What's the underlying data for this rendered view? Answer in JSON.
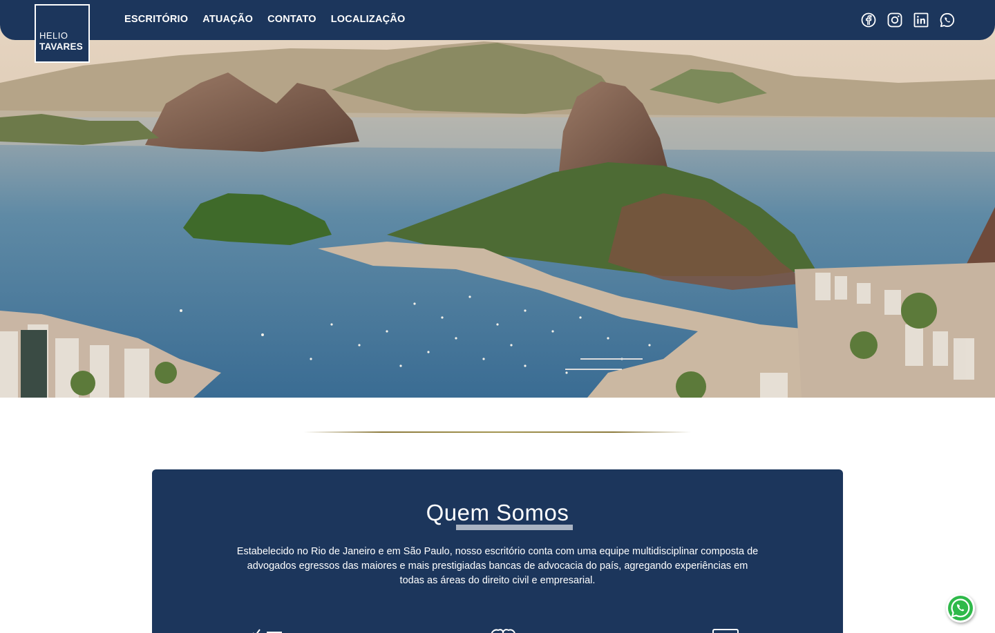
{
  "brand": {
    "line1": "HELIO",
    "line2": "TAVARES"
  },
  "nav": [
    {
      "label": "ESCRITÓRIO"
    },
    {
      "label": "ATUAÇÃO"
    },
    {
      "label": "CONTATO"
    },
    {
      "label": "LOCALIZAÇÃO"
    }
  ],
  "social": [
    "facebook-icon",
    "instagram-icon",
    "linkedin-icon",
    "whatsapp-icon"
  ],
  "hero": {
    "image": "Rio de Janeiro bay with Sugarloaf Mountain"
  },
  "about": {
    "title": "Quem Somos",
    "text": "Estabelecido no Rio de Janeiro e em São Paulo, nosso escritório conta com uma equipe multidisciplinar composta de advogados egressos das maiores e mais prestigiadas bancas de advocacia do país, agregando experiências em todas as áreas do direito civil e empresarial."
  },
  "features": [
    "checklist-icon",
    "handshake-icon",
    "monitor-icon"
  ],
  "float": {
    "icon": "whatsapp-icon"
  },
  "colors": {
    "primary": "#1c365c",
    "accent": "#a39550",
    "white": "#ffffff"
  }
}
